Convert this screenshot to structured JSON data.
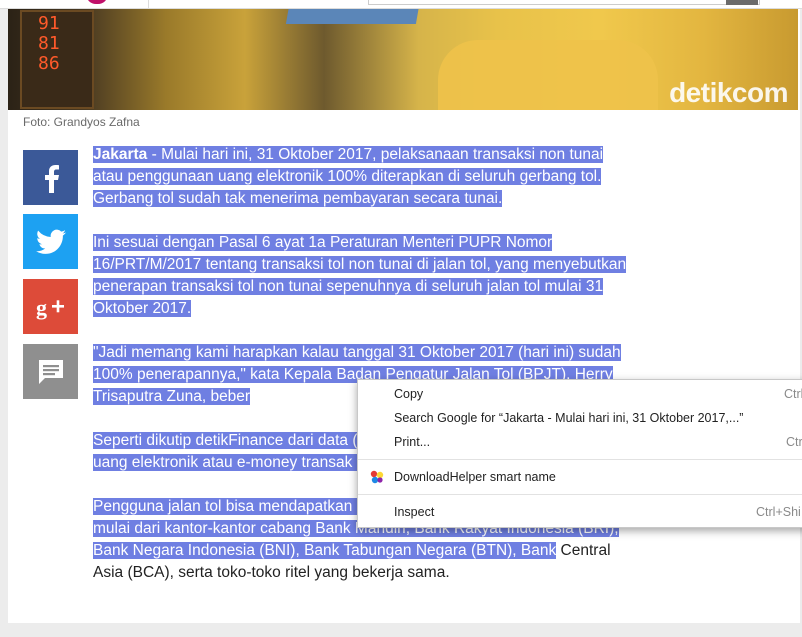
{
  "article": {
    "photo_credit": "Foto: Grandyos Zafna",
    "watermark": "detikcom",
    "photo_digits": "91\n81\n86",
    "location": "Jakarta",
    "p1_rest": " - Mulai hari ini, 31 Oktober 2017, pelaksanaan transaksi non tunai atau penggunaan uang elektronik 100% diterapkan di seluruh gerbang tol. Gerbang tol sudah tak menerima pembayaran secara tunai.",
    "p2": "Ini sesuai dengan Pasal 6 ayat 1a Peraturan Menteri PUPR Nomor 16/PRT/M/2017 tentang transaksi tol non tunai di jalan tol, yang menyebutkan penerapan transaksi tol non tunai sepenuhnya di seluruh jalan tol mulai 31 Oktober 2017.",
    "p3": "\"Jadi memang kami harapkan kalau tanggal 31 Oktober 2017 (hari ini) sudah 100% penerapannya,\" kata Kepala Badan Pengatur Jalan Tol (BPJT), Herry Trisaputra Zuna, beber",
    "p4": "Seperti dikutip detikFinance dari data (31/10/2017), penggunaan uang elekt uang elektronik atau e-money transak sebelumnya 7-8 detik, menjadi 2-3 de",
    "p5_hl": "Pengguna jalan tol bisa mendapatkan uang elektronik di berbagai tempat, mulai dari kantor-kantor cabang Bank Mandiri, Bank Rakyat Indonesia (BRI), Bank Negara Indonesia (BNI), Bank Tabungan Negara (BTN), Bank",
    "p5_rest": " Central Asia (BCA), serta toko-toko ritel yang bekerja sama."
  },
  "share": {
    "items": [
      {
        "name": "facebook",
        "icon": "facebook-icon",
        "color": "#3b5998"
      },
      {
        "name": "twitter",
        "icon": "twitter-icon",
        "color": "#1da1f2"
      },
      {
        "name": "google-plus",
        "icon": "google-plus-icon",
        "color": "#dd4b39"
      },
      {
        "name": "comment",
        "icon": "comment-icon",
        "color": "#8f8f8f"
      }
    ]
  },
  "context_menu": {
    "copy": "Copy",
    "copy_shortcut": "Ctrl",
    "search_google": "Search Google for “Jakarta - Mulai hari ini, 31 Oktober 2017,...”",
    "print": "Print...",
    "print_shortcut": "Ctr",
    "download_helper": "DownloadHelper smart name",
    "inspect": "Inspect",
    "inspect_shortcut": "Ctrl+Shi"
  },
  "colors": {
    "selection": "#6f7fe2",
    "accent": "#c0106a"
  }
}
